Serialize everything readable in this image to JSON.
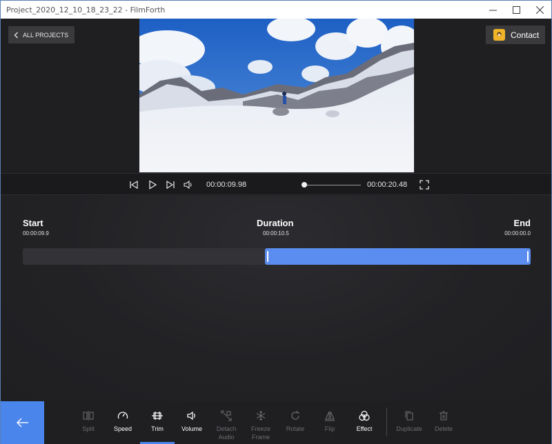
{
  "window": {
    "title": "Project_2020_12_10_18_23_22 - FilmForth",
    "controls": [
      "minimize-icon",
      "maximize-icon",
      "close-icon"
    ]
  },
  "header": {
    "all_projects_label": "ALL PROJECTS",
    "contact_label": "Contact"
  },
  "player": {
    "current_time": "00:00:09.98",
    "total_time": "00:00:20.48",
    "position_fraction": 0.0
  },
  "trim": {
    "start_label": "Start",
    "start_value": "00:00:09.9",
    "duration_label": "Duration",
    "duration_value": "00:00:10.5",
    "end_label": "End",
    "end_value": "00:00:00.0",
    "selection_start_fraction": 0.478,
    "selection_end_fraction": 1.0
  },
  "toolbar": {
    "tools": [
      {
        "label": "Split",
        "icon": "split-icon",
        "enabled": false
      },
      {
        "label": "Speed",
        "icon": "speed-icon",
        "enabled": true
      },
      {
        "label": "Trim",
        "icon": "trim-icon",
        "enabled": true,
        "active": true
      },
      {
        "label": "Volume",
        "icon": "volume-icon",
        "enabled": true
      },
      {
        "label": "Detach Audio",
        "icon": "detach-audio-icon",
        "enabled": false
      },
      {
        "label": "Freeze Frame",
        "icon": "freeze-frame-icon",
        "enabled": false
      },
      {
        "label": "Rotate",
        "icon": "rotate-icon",
        "enabled": false
      },
      {
        "label": "Flip",
        "icon": "flip-icon",
        "enabled": false
      },
      {
        "label": "Effect",
        "icon": "effect-icon",
        "enabled": true
      },
      {
        "label": "Duplicate",
        "icon": "duplicate-icon",
        "enabled": false
      },
      {
        "label": "Delete",
        "icon": "delete-icon",
        "enabled": false
      }
    ]
  },
  "colors": {
    "accent": "#4a85ec",
    "selection": "#5b8df0",
    "background": "#1f1f22"
  }
}
